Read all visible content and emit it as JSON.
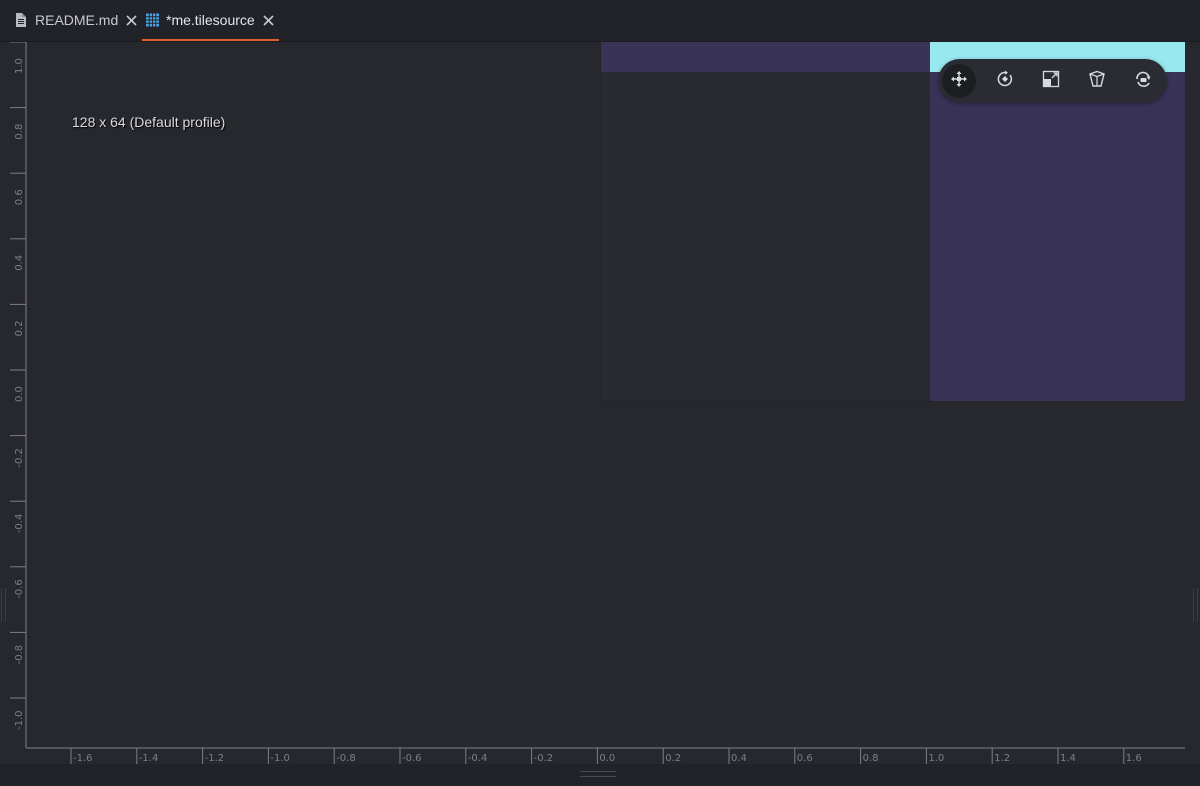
{
  "tabs": [
    {
      "label": "README.md",
      "icon": "document-icon",
      "active": false
    },
    {
      "label": "*me.tilesource",
      "icon": "tilesource-grid-icon",
      "active": true
    }
  ],
  "colors": {
    "tab_active_underline": "#e0602b",
    "background": "#27282e",
    "tile_purple": "#3a3358",
    "tile_cyan": "#98e8f0",
    "tile_dark": "#2a2b30",
    "ruler": "#7d7f86"
  },
  "viewport": {
    "profile_label": "128 x 64 (Default profile)",
    "x_axis_ticks": [
      "-1.6",
      "-1.4",
      "-1.2",
      "-1.0",
      "-0.8",
      "-0.6",
      "-0.4",
      "-0.2",
      "0.0",
      "0.2",
      "0.4",
      "0.6",
      "0.8",
      "1.0",
      "1.2",
      "1.4",
      "1.6"
    ],
    "y_axis_ticks": [
      "1.0",
      "0.8",
      "0.6",
      "0.4",
      "0.2",
      "0.0",
      "-0.2",
      "-0.4",
      "-0.6",
      "-0.8",
      "-1.0"
    ]
  },
  "toolbar": {
    "tools": [
      {
        "name": "move-tool",
        "icon": "move-icon",
        "active": true
      },
      {
        "name": "rotate-tool",
        "icon": "rotate-icon",
        "active": false
      },
      {
        "name": "scale-tool",
        "icon": "scale-icon",
        "active": false
      },
      {
        "name": "perspective-tool",
        "icon": "perspective-icon",
        "active": false
      },
      {
        "name": "camera-tool",
        "icon": "camera-rotate-icon",
        "active": false
      }
    ]
  }
}
